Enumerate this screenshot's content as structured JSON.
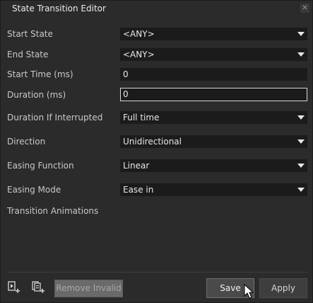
{
  "window": {
    "title": "State Transition Editor",
    "close_symbol": "✕"
  },
  "form": {
    "start_state": {
      "label": "Start State",
      "value": "<ANY>"
    },
    "end_state": {
      "label": "End State",
      "value": "<ANY>"
    },
    "start_time": {
      "label": "Start Time (ms)",
      "value": "0"
    },
    "duration": {
      "label": "Duration (ms)",
      "value": "0"
    },
    "duration_if_interrupted": {
      "label": "Duration If Interrupted",
      "value": "Full time"
    },
    "direction": {
      "label": "Direction",
      "value": "Unidirectional"
    },
    "easing_function": {
      "label": "Easing Function",
      "value": "Linear"
    },
    "easing_mode": {
      "label": "Easing Mode",
      "value": "Ease in"
    },
    "transition_animations_label": "Transition Animations"
  },
  "footer": {
    "add_animation_icon": "add-animation-icon",
    "add_copy_icon": "add-copy-icon",
    "remove_invalid_label": "Remove Invalid",
    "save_label": "Save",
    "apply_label": "Apply"
  }
}
